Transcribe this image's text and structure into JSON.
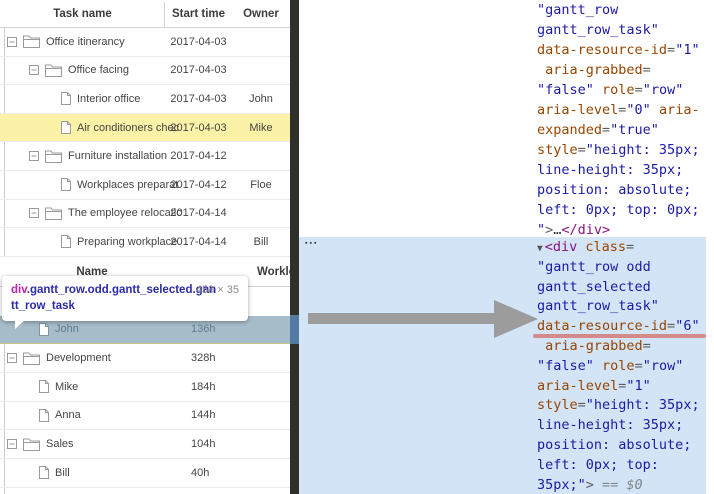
{
  "palette": {
    "accent_yellow": "#FBF1A7",
    "selected_row_blue": "#A6BCC9",
    "devtools_highlight_blue": "#D2E4F6",
    "splitter_dark": "#30302B",
    "splitter_selected_blue": "#527AA2",
    "syntax_attr": "#994500",
    "syntax_value": "#1A1AA6",
    "syntax_tag": "#881280",
    "annotation_arrow_gray": "#9C9C9C",
    "annotation_underline_red": "#D58A8A"
  },
  "task_grid": {
    "columns": [
      "Task name",
      "Start time",
      "Owner"
    ],
    "rows": [
      {
        "name": "Office itinerancy",
        "start": "2017-04-03",
        "owner": "",
        "kind": "parent",
        "level": 0,
        "highlight": false
      },
      {
        "name": "Office facing",
        "start": "2017-04-03",
        "owner": "",
        "kind": "parent",
        "level": 1,
        "highlight": false
      },
      {
        "name": "Interior office",
        "start": "2017-04-03",
        "owner": "John",
        "kind": "leaf",
        "level": 2,
        "highlight": false
      },
      {
        "name": "Air conditioners chec",
        "start": "2017-04-03",
        "owner": "Mike",
        "kind": "leaf",
        "level": 2,
        "highlight": true
      },
      {
        "name": "Furniture installation",
        "start": "2017-04-12",
        "owner": "",
        "kind": "parent",
        "level": 1,
        "highlight": false
      },
      {
        "name": "Workplaces preparat",
        "start": "2017-04-12",
        "owner": "Floe",
        "kind": "leaf",
        "level": 2,
        "highlight": false
      },
      {
        "name": "The employee relocatic",
        "start": "2017-04-14",
        "owner": "",
        "kind": "parent",
        "level": 1,
        "highlight": false
      },
      {
        "name": "Preparing workplace",
        "start": "2017-04-14",
        "owner": "Bill",
        "kind": "leaf",
        "level": 2,
        "highlight": false
      }
    ]
  },
  "resource_grid": {
    "columns": [
      "Name",
      "Workload"
    ],
    "rows": [
      {
        "name": "John",
        "workload": "136h",
        "kind": "leaf",
        "level": 1,
        "selected": true
      },
      {
        "name": "Development",
        "workload": "328h",
        "kind": "parent",
        "level": 0,
        "selected": false
      },
      {
        "name": "Mike",
        "workload": "184h",
        "kind": "leaf",
        "level": 1,
        "selected": false
      },
      {
        "name": "Anna",
        "workload": "144h",
        "kind": "leaf",
        "level": 1,
        "selected": false
      },
      {
        "name": "Sales",
        "workload": "104h",
        "kind": "parent",
        "level": 0,
        "selected": false
      },
      {
        "name": "Bill",
        "workload": "40h",
        "kind": "leaf",
        "level": 1,
        "selected": false
      }
    ]
  },
  "tooltip": {
    "tag": "div",
    "classes": ".gantt_row.odd.gantt_selected.gantt_row_task",
    "dimensions": "458 × 35"
  },
  "inspector": {
    "dots": "▪▪▪",
    "blocks": [
      {
        "bg": "white",
        "lines": [
          {
            "tokens": [
              [
                "\"gantt_row",
                "v"
              ]
            ]
          },
          {
            "tokens": [
              [
                "gantt_row_task\"",
                "v"
              ]
            ]
          },
          {
            "tokens": [
              [
                "data-resource-id",
                "a"
              ],
              [
                "=",
                "p"
              ],
              [
                "\"1\"",
                "v"
              ]
            ]
          },
          {
            "tokens": [
              [
                " aria-grabbed",
                "a"
              ],
              [
                "=",
                "p"
              ]
            ]
          },
          {
            "tokens": [
              [
                "\"false\"",
                "v"
              ],
              [
                " ",
                "p"
              ],
              [
                "role",
                "a"
              ],
              [
                "=",
                "p"
              ],
              [
                "\"row\"",
                "v"
              ]
            ]
          },
          {
            "tokens": [
              [
                "aria-level",
                "a"
              ],
              [
                "=",
                "p"
              ],
              [
                "\"0\"",
                "v"
              ],
              [
                " ",
                "p"
              ],
              [
                "aria-",
                "a"
              ]
            ]
          },
          {
            "tokens": [
              [
                "expanded",
                "a"
              ],
              [
                "=",
                "p"
              ],
              [
                "\"true\"",
                "v"
              ]
            ]
          },
          {
            "tokens": [
              [
                "style",
                "a"
              ],
              [
                "=",
                "p"
              ],
              [
                "\"height: 35px;",
                "v"
              ]
            ]
          },
          {
            "tokens": [
              [
                "line-height: 35px;",
                "v"
              ]
            ]
          },
          {
            "tokens": [
              [
                "position: absolute;",
                "v"
              ]
            ]
          },
          {
            "tokens": [
              [
                "left: 0px; top: 0px;",
                "v"
              ]
            ]
          },
          {
            "tokens": [
              [
                "\"",
                "v"
              ],
              [
                ">",
                "p"
              ],
              [
                "…",
                "e"
              ],
              [
                "</div>",
                "t"
              ]
            ]
          }
        ]
      },
      {
        "bg": "blue",
        "lines": [
          {
            "tokens": [
              [
                "▼",
                "w"
              ],
              [
                "<div",
                "t"
              ],
              [
                " ",
                "p"
              ],
              [
                "class",
                "a"
              ],
              [
                "=",
                "p"
              ]
            ]
          },
          {
            "tokens": [
              [
                "\"gantt_row odd",
                "v"
              ]
            ]
          },
          {
            "tokens": [
              [
                "gantt_selected",
                "v"
              ]
            ]
          },
          {
            "tokens": [
              [
                "gantt_row_task\"",
                "v"
              ]
            ]
          },
          {
            "tokens": [
              [
                "data-resource-id",
                "a"
              ],
              [
                "=",
                "p"
              ],
              [
                "\"6\"",
                "v"
              ]
            ],
            "underline": true
          },
          {
            "tokens": [
              [
                " aria-grabbed",
                "a"
              ],
              [
                "=",
                "p"
              ]
            ]
          },
          {
            "tokens": [
              [
                "\"false\"",
                "v"
              ],
              [
                " ",
                "p"
              ],
              [
                "role",
                "a"
              ],
              [
                "=",
                "p"
              ],
              [
                "\"row\"",
                "v"
              ]
            ]
          },
          {
            "tokens": [
              [
                "aria-level",
                "a"
              ],
              [
                "=",
                "p"
              ],
              [
                "\"1\"",
                "v"
              ]
            ]
          },
          {
            "tokens": [
              [
                "style",
                "a"
              ],
              [
                "=",
                "p"
              ],
              [
                "\"height: 35px;",
                "v"
              ]
            ]
          },
          {
            "tokens": [
              [
                "line-height: 35px;",
                "v"
              ]
            ]
          },
          {
            "tokens": [
              [
                "position: absolute;",
                "v"
              ]
            ]
          },
          {
            "tokens": [
              [
                "left: 0px; top:",
                "v"
              ]
            ]
          },
          {
            "tokens": [
              [
                "35px;\"",
                "v"
              ],
              [
                ">",
                "p"
              ],
              [
                " == $0",
                "m"
              ]
            ]
          }
        ]
      }
    ]
  }
}
